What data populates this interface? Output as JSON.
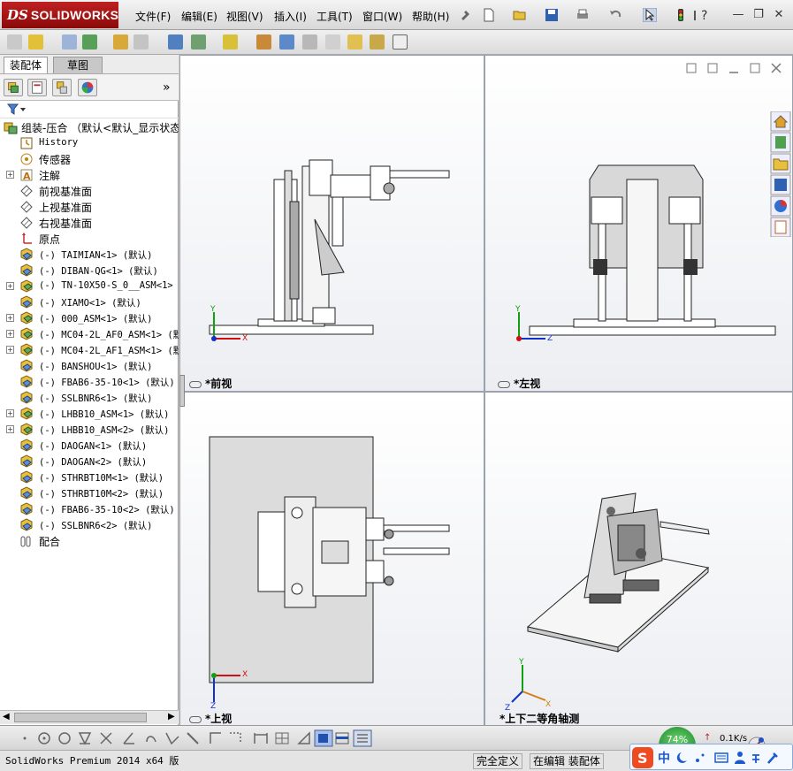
{
  "app": {
    "logo_ds": "DS",
    "logo_text": "SOLIDWORKS"
  },
  "menu": [
    "文件(F)",
    "编辑(E)",
    "视图(V)",
    "插入(I)",
    "工具(T)",
    "窗口(W)",
    "帮助(H)"
  ],
  "feature_manager": {
    "tabs": [
      "装配体",
      "草图"
    ],
    "expand_label": "»",
    "root": "组装-压合  （默认<默认_显示状态",
    "items": [
      {
        "label": "History",
        "icon": "history-icon",
        "expand": false,
        "cjk": false
      },
      {
        "label": "传感器",
        "icon": "sensor-icon",
        "expand": false,
        "cjk": true
      },
      {
        "label": "注解",
        "icon": "annotation-icon",
        "expand": true,
        "cjk": true
      },
      {
        "label": "前视基准面",
        "icon": "plane-icon",
        "expand": false,
        "cjk": true
      },
      {
        "label": "上视基准面",
        "icon": "plane-icon",
        "expand": false,
        "cjk": true
      },
      {
        "label": "右视基准面",
        "icon": "plane-icon",
        "expand": false,
        "cjk": true
      },
      {
        "label": "原点",
        "icon": "origin-icon",
        "expand": false,
        "cjk": true
      },
      {
        "label": "(-) TAIMIAN<1> (默认)",
        "icon": "part-icon",
        "expand": false,
        "cjk": false
      },
      {
        "label": "(-) DIBAN-QG<1> (默认)",
        "icon": "part-icon",
        "expand": false,
        "cjk": false
      },
      {
        "label": "(-) TN-10X50-S_0__ASM<1> (",
        "icon": "assembly-icon",
        "expand": true,
        "cjk": false
      },
      {
        "label": "(-) XIAMO<1> (默认)",
        "icon": "part-icon",
        "expand": false,
        "cjk": false
      },
      {
        "label": "(-) 000_ASM<1> (默认)",
        "icon": "assembly-icon",
        "expand": true,
        "cjk": false
      },
      {
        "label": "(-) MC04-2L_AF0_ASM<1> (默认",
        "icon": "assembly-icon",
        "expand": true,
        "cjk": false
      },
      {
        "label": "(-) MC04-2L_AF1_ASM<1> (默认",
        "icon": "assembly-icon",
        "expand": true,
        "cjk": false
      },
      {
        "label": "(-) BANSHOU<1> (默认)",
        "icon": "part-icon",
        "expand": false,
        "cjk": false
      },
      {
        "label": "(-) FBAB6-35-10<1> (默认)",
        "icon": "part-icon",
        "expand": false,
        "cjk": false
      },
      {
        "label": "(-) SSLBNR6<1> (默认)",
        "icon": "part-icon",
        "expand": false,
        "cjk": false
      },
      {
        "label": "(-) LHBB10_ASM<1> (默认)",
        "icon": "assembly-icon",
        "expand": true,
        "cjk": false
      },
      {
        "label": "(-) LHBB10_ASM<2> (默认)",
        "icon": "assembly-icon",
        "expand": true,
        "cjk": false
      },
      {
        "label": "(-) DAOGAN<1> (默认)",
        "icon": "part-icon",
        "expand": false,
        "cjk": false
      },
      {
        "label": "(-) DAOGAN<2> (默认)",
        "icon": "part-icon",
        "expand": false,
        "cjk": false
      },
      {
        "label": "(-) STHRBT10M<1> (默认)",
        "icon": "part-icon",
        "expand": false,
        "cjk": false
      },
      {
        "label": "(-) STHRBT10M<2> (默认)",
        "icon": "part-icon",
        "expand": false,
        "cjk": false
      },
      {
        "label": "(-) FBAB6-35-10<2> (默认)",
        "icon": "part-icon",
        "expand": false,
        "cjk": false
      },
      {
        "label": "(-) SSLBNR6<2> (默认)",
        "icon": "part-icon",
        "expand": false,
        "cjk": false
      },
      {
        "label": "配合",
        "icon": "mate-icon",
        "expand": false,
        "cjk": true
      }
    ]
  },
  "viewports": {
    "front": {
      "label": "*前视"
    },
    "left": {
      "label": "*左视"
    },
    "top": {
      "label": "*上视"
    },
    "iso": {
      "label": "*上下二等角轴测"
    }
  },
  "axes": {
    "x": "X",
    "y": "Y",
    "z": "Z"
  },
  "status": {
    "app_name": "SolidWorks Premium 2014 x64 版",
    "definition": "完全定义",
    "mode": "在编辑 装配体"
  },
  "tray": {
    "percent": "74%",
    "speed": "0.1K/s",
    "ime_label": "中"
  },
  "colors": {
    "accent_red": "#b01818",
    "x_axis": "#d01010",
    "y_axis": "#10a010",
    "z_axis": "#1030d0"
  }
}
